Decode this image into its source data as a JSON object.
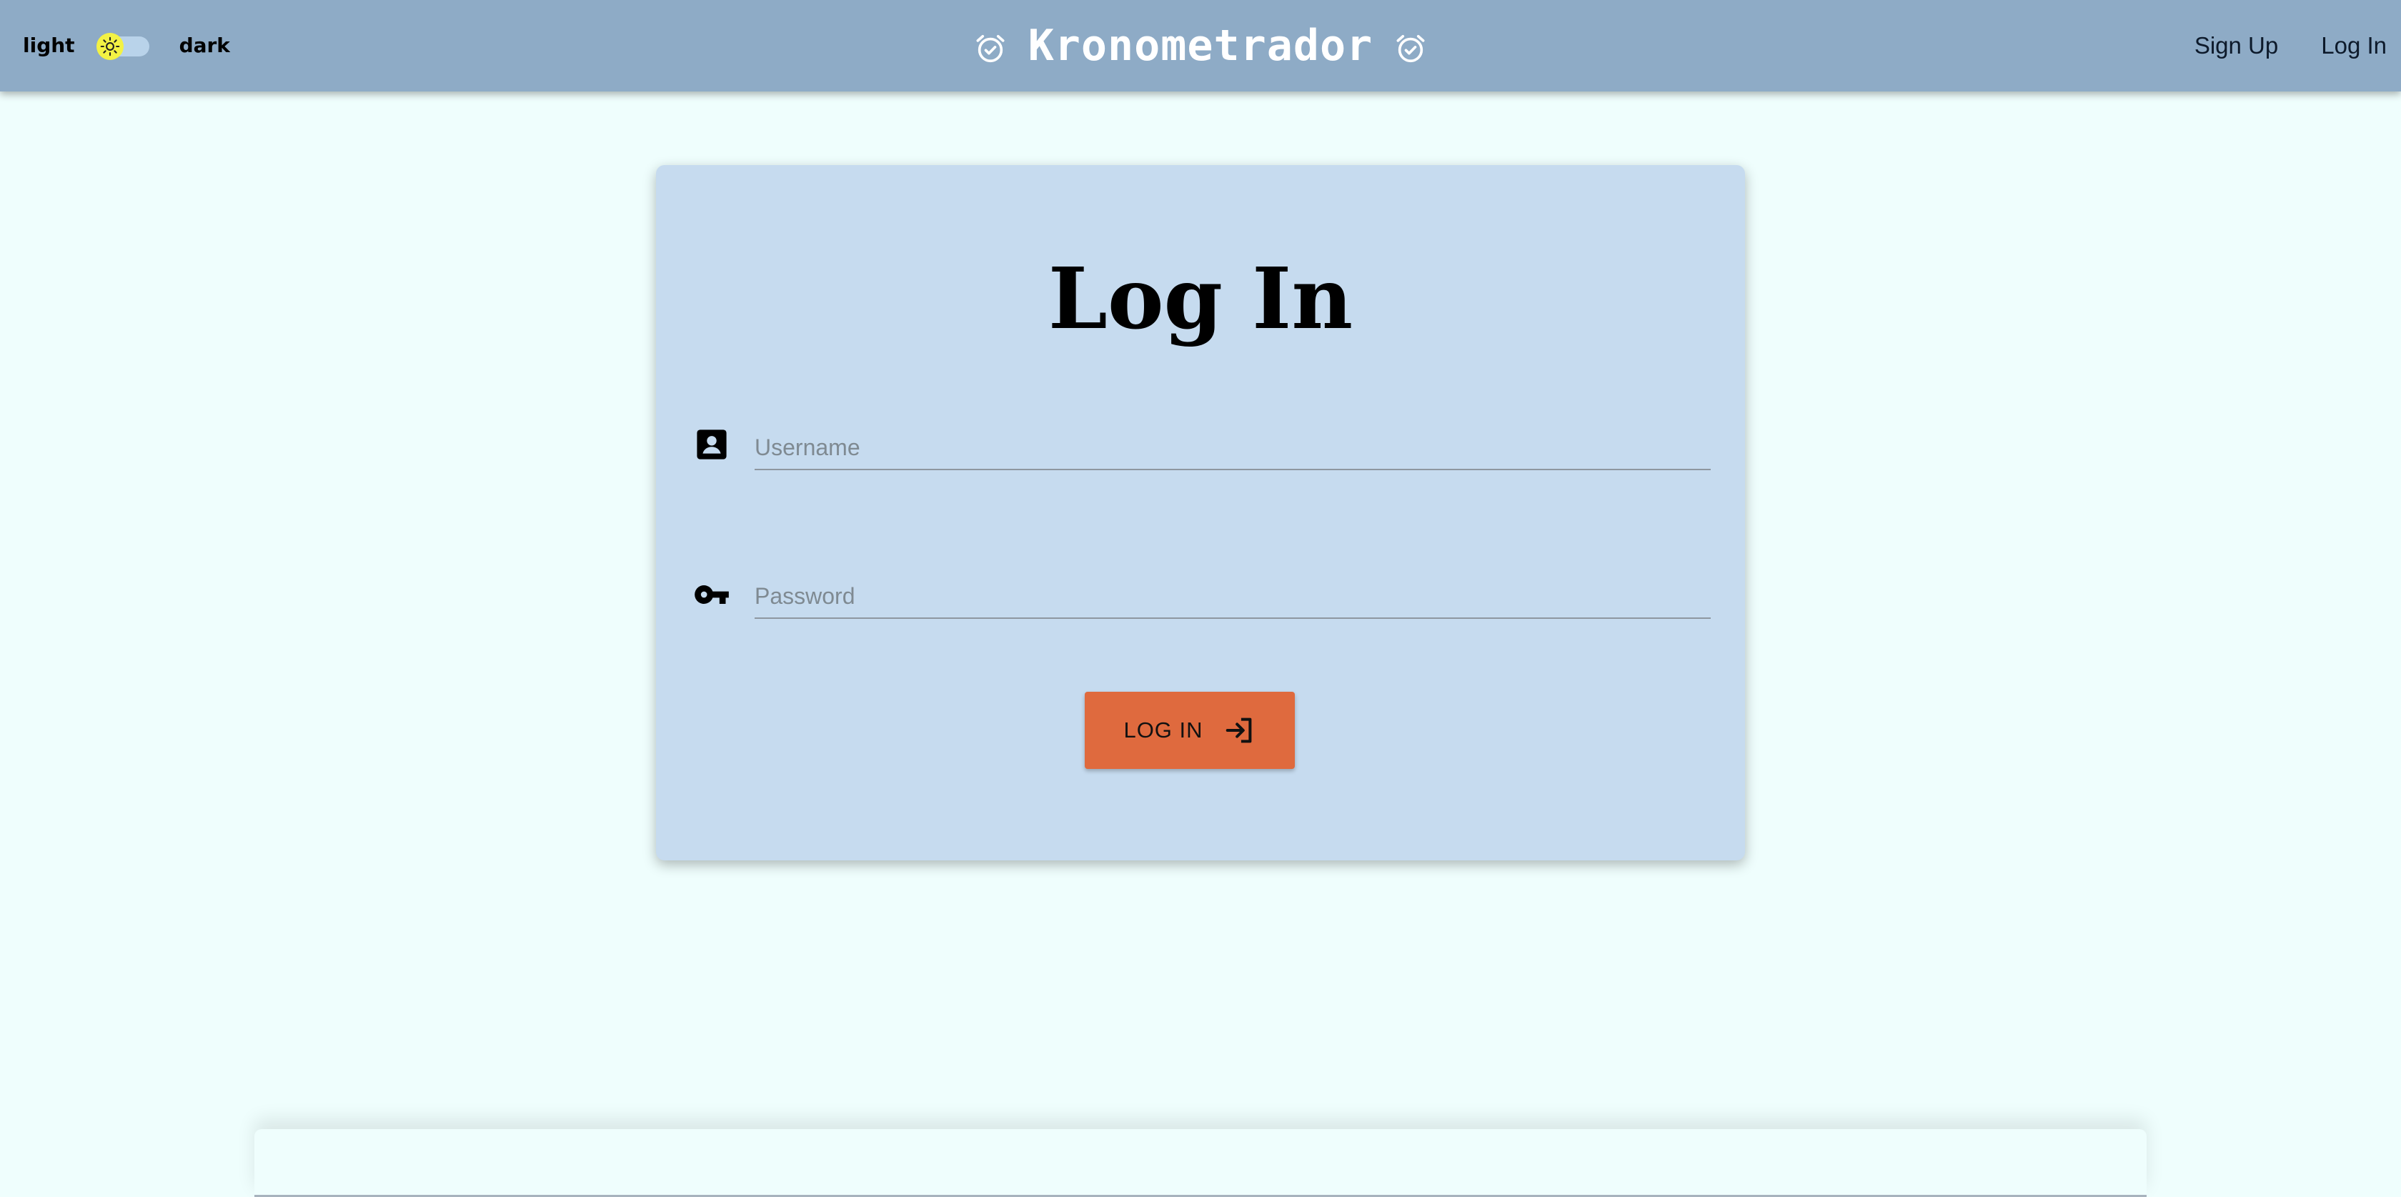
{
  "theme": {
    "light_label": "light",
    "dark_label": "dark",
    "mode": "light",
    "thumb_color": "#f3f244",
    "track_color": "#b9d3ea"
  },
  "header": {
    "brand": "Kronometrador",
    "brand_icon": "alarm-check-icon",
    "background": "#8eabc6",
    "nav": {
      "signup_label": "Sign Up",
      "login_label": "Log In"
    }
  },
  "login": {
    "title": "Log In",
    "card_background": "#c6dbef",
    "username": {
      "icon": "contact-card-icon",
      "placeholder": "Username",
      "value": ""
    },
    "password": {
      "icon": "key-icon",
      "placeholder": "Password",
      "value": ""
    },
    "submit": {
      "label": "LOG IN",
      "icon": "login-arrow-icon",
      "background": "#df6a3e"
    }
  },
  "page": {
    "background": "#effefd"
  }
}
